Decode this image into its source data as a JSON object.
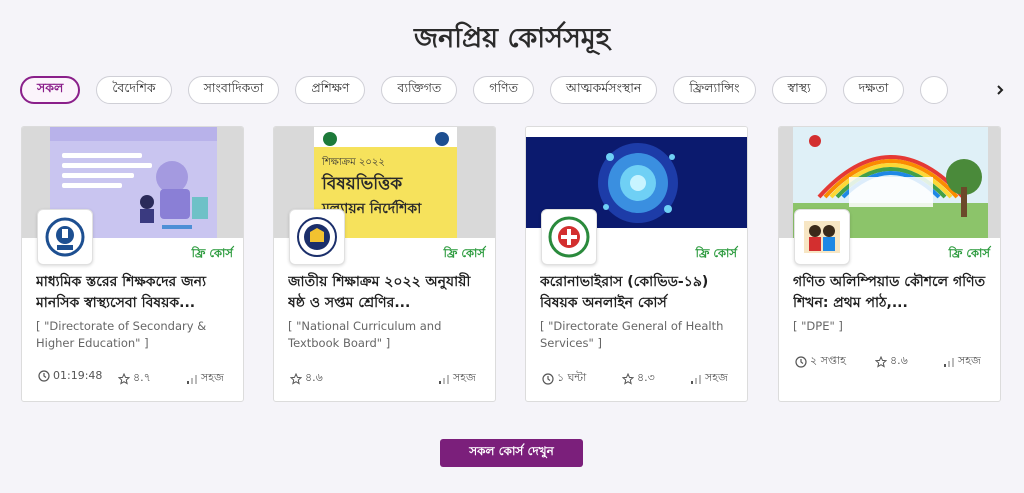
{
  "section": {
    "title": "জনপ্রিয় কোর্সসমূহ"
  },
  "filters": [
    {
      "label": "সকল",
      "active": true
    },
    {
      "label": "বৈদেশিক"
    },
    {
      "label": "সাংবাদিকতা"
    },
    {
      "label": "প্রশিক্ষণ"
    },
    {
      "label": "ব্যক্তিগত"
    },
    {
      "label": "গণিত"
    },
    {
      "label": "আত্মকর্মসংস্থান"
    },
    {
      "label": "ফ্রিল্যান্সিং"
    },
    {
      "label": "স্বাস্থ্য"
    },
    {
      "label": "দক্ষতা"
    }
  ],
  "next_icon": "chevron-right-icon",
  "courses": [
    {
      "badge": "ফ্রি কোর্স",
      "title": "মাধ্যমিক স্তরের শিক্ষকদের জন্য মানসিক স্বাস্থ্যসেবা বিষয়ক...",
      "org": "[ \"Directorate of Secondary & Higher Education\" ]",
      "duration": "01:19:48",
      "rating": "৪.৭",
      "level": "সহজ"
    },
    {
      "badge": "ফ্রি কোর্স",
      "title": "জাতীয় শিক্ষাক্রম ২০২২ অনুযায়ী ষষ্ঠ ও সপ্তম শ্রেণির...",
      "org": "[ \"National Curriculum and Textbook Board\" ]",
      "thumb_line1": "শিক্ষাক্রম ২০২২",
      "thumb_line2": "বিষয়ভিত্তিক",
      "thumb_line3": "মূল্যায়ন নির্দেশিকা",
      "rating": "৪.৬",
      "level": "সহজ"
    },
    {
      "badge": "ফ্রি কোর্স",
      "title": "করোনাভাইরাস (কোভিড-১৯) বিষয়ক অনলাইন কোর্স",
      "org": "[ \"Directorate General of Health Services\" ]",
      "duration": "১ ঘন্টা",
      "rating": "৪.৩",
      "level": "সহজ"
    },
    {
      "badge": "ফ্রি কোর্স",
      "title": "গণিত অলিম্পিয়াড কৌশলে গণিত শিখন: প্রথম পাঠ,...",
      "org": "[ \"DPE\" ]",
      "duration": "২ সপ্তাহ",
      "rating": "৪.৬",
      "level": "সহজ"
    }
  ],
  "cta": {
    "label": "সকল কোর্স দেখুন"
  },
  "colors": {
    "brand": "#7b1f7b",
    "free_badge": "#2a9a3c",
    "background": "#f5f4f9"
  }
}
